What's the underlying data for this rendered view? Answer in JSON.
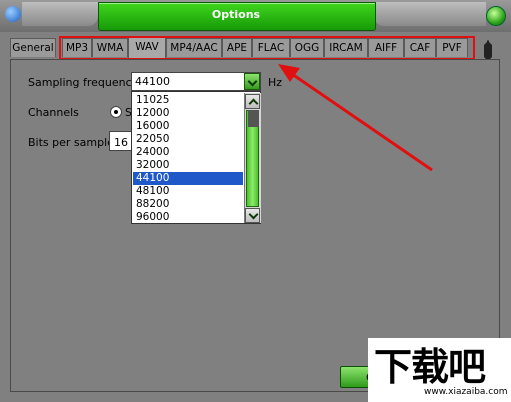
{
  "window": {
    "title": "Options"
  },
  "tabs": [
    {
      "label": "General",
      "active": false
    },
    {
      "label": "MP3",
      "active": false
    },
    {
      "label": "WMA",
      "active": false
    },
    {
      "label": "WAV",
      "active": true
    },
    {
      "label": "MP4/AAC",
      "active": false
    },
    {
      "label": "APE",
      "active": false
    },
    {
      "label": "FLAC",
      "active": false
    },
    {
      "label": "OGG",
      "active": false
    },
    {
      "label": "IRCAM",
      "active": false
    },
    {
      "label": "AIFF",
      "active": false
    },
    {
      "label": "CAF",
      "active": false
    },
    {
      "label": "PVF",
      "active": false
    }
  ],
  "form": {
    "sampling_frequency_label": "Sampling frequency",
    "sampling_frequency_value": "44100",
    "sampling_unit": "Hz",
    "channels_label": "Channels",
    "channels_option_partial": "S",
    "bits_per_sample_label": "Bits per sample",
    "bits_per_sample_partial": "16 b"
  },
  "dropdown": {
    "options": [
      "11025",
      "12000",
      "16000",
      "22050",
      "24000",
      "32000",
      "44100",
      "48100",
      "88200",
      "96000"
    ],
    "selected": "44100"
  },
  "buttons": {
    "ok_partial": "O"
  },
  "watermark": {
    "text": "下载吧",
    "url": "www.xiazaiba.com"
  },
  "colors": {
    "accent_green": "#169a07",
    "selection_blue": "#1f59c9",
    "annotation_red": "#e01010"
  }
}
